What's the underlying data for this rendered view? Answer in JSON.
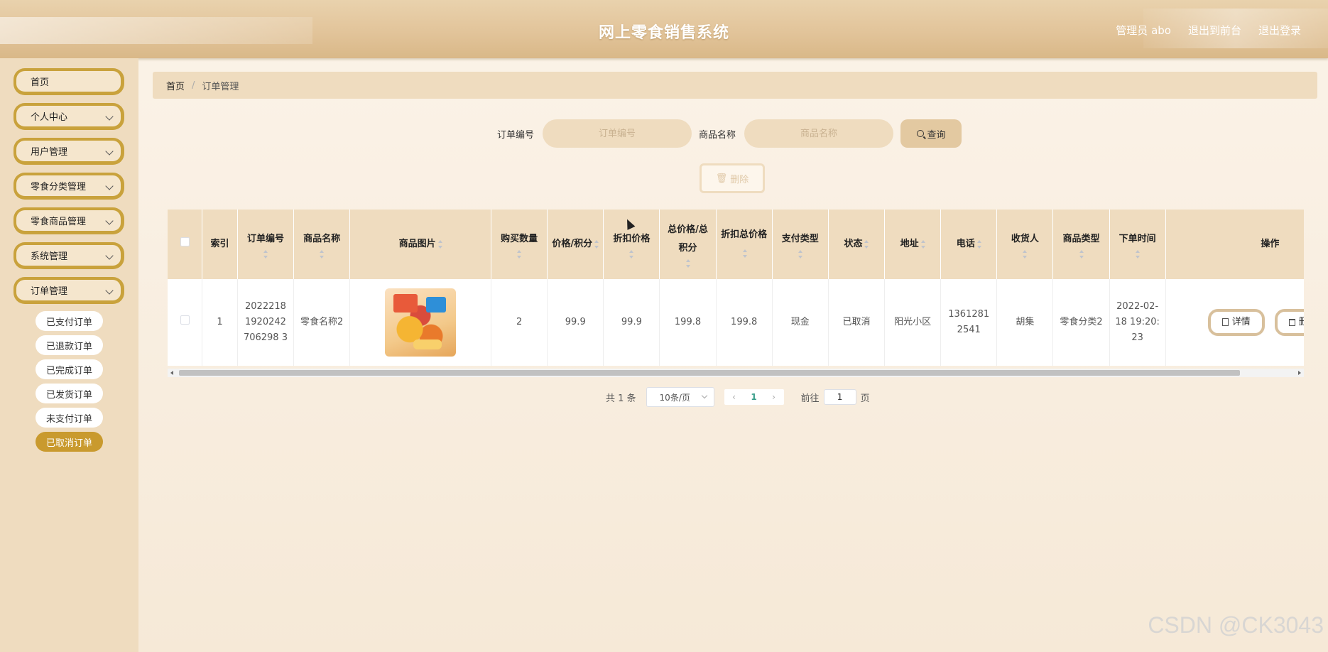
{
  "header": {
    "title": "网上零食销售系统",
    "admin_label": "管理员 abo",
    "to_front_label": "退出到前台",
    "logout_label": "退出登录"
  },
  "sidebar": {
    "items": [
      {
        "label": "首页"
      },
      {
        "label": "个人中心"
      },
      {
        "label": "用户管理"
      },
      {
        "label": "零食分类管理"
      },
      {
        "label": "零食商品管理"
      },
      {
        "label": "系统管理"
      },
      {
        "label": "订单管理"
      }
    ],
    "sub_items": [
      {
        "label": "已支付订单"
      },
      {
        "label": "已退款订单"
      },
      {
        "label": "已完成订单"
      },
      {
        "label": "已发货订单"
      },
      {
        "label": "未支付订单"
      },
      {
        "label": "已取消订单",
        "active": true
      }
    ]
  },
  "breadcrumb": {
    "home": "首页",
    "current": "订单管理"
  },
  "search": {
    "order_no_label": "订单编号",
    "order_no_placeholder": "订单编号",
    "goods_name_label": "商品名称",
    "goods_name_placeholder": "商品名称",
    "query_label": "查询"
  },
  "batch_delete_label": "删除",
  "table": {
    "columns": {
      "index": "索引",
      "order_no": "订单编号",
      "goods_name": "商品名称",
      "goods_image": "商品图片",
      "quantity": "购买数量",
      "price": "价格/积分",
      "discount_price": "折扣价格",
      "total_price": "总价格/总积分",
      "discount_total": "折扣总价格",
      "pay_type": "支付类型",
      "status": "状态",
      "address": "地址",
      "phone": "电话",
      "receiver": "收货人",
      "goods_type": "商品类型",
      "order_time": "下单时间",
      "actions": "操作"
    },
    "rows": [
      {
        "index": "1",
        "order_no": "20222181920242706298 3",
        "goods_name": "零食名称2",
        "quantity": "2",
        "price": "99.9",
        "discount_price": "99.9",
        "total_price": "199.8",
        "discount_total": "199.8",
        "pay_type": "现金",
        "status": "已取消",
        "address": "阳光小区",
        "phone": "13612812541",
        "receiver": "胡集",
        "goods_type": "零食分类2",
        "order_time": "2022-02-18 19:20:23",
        "detail_label": "详情",
        "delete_label": "删除"
      }
    ]
  },
  "pagination": {
    "total_text": "共 1 条",
    "page_size": "10条/页",
    "current_page": "1",
    "goto_prefix": "前往",
    "goto_value": "1",
    "goto_suffix": "页"
  },
  "watermark": "CSDN @CK3043"
}
